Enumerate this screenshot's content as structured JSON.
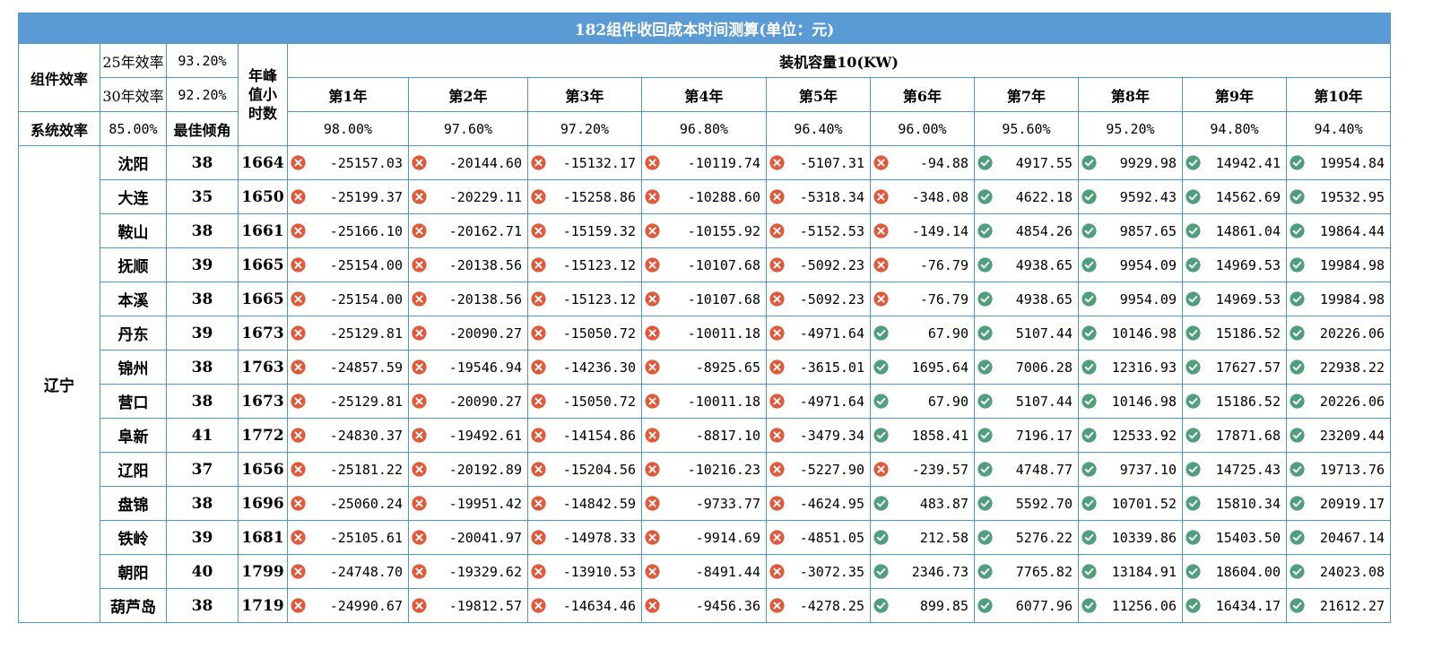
{
  "title": "182组件收回成本时间测算(单位：元)",
  "labels": {
    "module_eff": "组件效率",
    "eff25_label": "25年效率",
    "eff25_value": "93.20%",
    "eff30_label": "30年效率",
    "eff30_value": "92.20%",
    "peak_hours": "年峰值小时数",
    "capacity": "装机容量10(KW)",
    "system_eff": "系统效率",
    "system_eff_value": "85.00%",
    "best_tilt": "最佳倾角",
    "province": "辽宁"
  },
  "years": [
    "第1年",
    "第2年",
    "第3年",
    "第4年",
    "第5年",
    "第6年",
    "第7年",
    "第8年",
    "第9年",
    "第10年"
  ],
  "year_efficiency": [
    "98.00%",
    "97.60%",
    "97.20%",
    "96.80%",
    "96.40%",
    "96.00%",
    "95.60%",
    "95.20%",
    "94.80%",
    "94.40%"
  ],
  "icons": {
    "negative": "x-circle-icon",
    "positive": "check-circle-icon",
    "negative_color": "#e05a3a",
    "positive_color": "#4f9e7c",
    "border_color": "#4f96cf",
    "title_bg": "#5b9bd5"
  },
  "rows": [
    {
      "city": "沈阳",
      "angle": "38",
      "peak": "1664",
      "values": [
        "-25157.03",
        "-20144.60",
        "-15132.17",
        "-10119.74",
        "-5107.31",
        "-94.88",
        "4917.55",
        "9929.98",
        "14942.41",
        "19954.84"
      ]
    },
    {
      "city": "大连",
      "angle": "35",
      "peak": "1650",
      "values": [
        "-25199.37",
        "-20229.11",
        "-15258.86",
        "-10288.60",
        "-5318.34",
        "-348.08",
        "4622.18",
        "9592.43",
        "14562.69",
        "19532.95"
      ]
    },
    {
      "city": "鞍山",
      "angle": "38",
      "peak": "1661",
      "values": [
        "-25166.10",
        "-20162.71",
        "-15159.32",
        "-10155.92",
        "-5152.53",
        "-149.14",
        "4854.26",
        "9857.65",
        "14861.04",
        "19864.44"
      ]
    },
    {
      "city": "抚顺",
      "angle": "39",
      "peak": "1665",
      "values": [
        "-25154.00",
        "-20138.56",
        "-15123.12",
        "-10107.68",
        "-5092.23",
        "-76.79",
        "4938.65",
        "9954.09",
        "14969.53",
        "19984.98"
      ]
    },
    {
      "city": "本溪",
      "angle": "38",
      "peak": "1665",
      "values": [
        "-25154.00",
        "-20138.56",
        "-15123.12",
        "-10107.68",
        "-5092.23",
        "-76.79",
        "4938.65",
        "9954.09",
        "14969.53",
        "19984.98"
      ]
    },
    {
      "city": "丹东",
      "angle": "39",
      "peak": "1673",
      "values": [
        "-25129.81",
        "-20090.27",
        "-15050.72",
        "-10011.18",
        "-4971.64",
        "67.90",
        "5107.44",
        "10146.98",
        "15186.52",
        "20226.06"
      ]
    },
    {
      "city": "锦州",
      "angle": "38",
      "peak": "1763",
      "values": [
        "-24857.59",
        "-19546.94",
        "-14236.30",
        "-8925.65",
        "-3615.01",
        "1695.64",
        "7006.28",
        "12316.93",
        "17627.57",
        "22938.22"
      ]
    },
    {
      "city": "营口",
      "angle": "38",
      "peak": "1673",
      "values": [
        "-25129.81",
        "-20090.27",
        "-15050.72",
        "-10011.18",
        "-4971.64",
        "67.90",
        "5107.44",
        "10146.98",
        "15186.52",
        "20226.06"
      ]
    },
    {
      "city": "阜新",
      "angle": "41",
      "peak": "1772",
      "values": [
        "-24830.37",
        "-19492.61",
        "-14154.86",
        "-8817.10",
        "-3479.34",
        "1858.41",
        "7196.17",
        "12533.92",
        "17871.68",
        "23209.44"
      ]
    },
    {
      "city": "辽阳",
      "angle": "37",
      "peak": "1656",
      "values": [
        "-25181.22",
        "-20192.89",
        "-15204.56",
        "-10216.23",
        "-5227.90",
        "-239.57",
        "4748.77",
        "9737.10",
        "14725.43",
        "19713.76"
      ]
    },
    {
      "city": "盘锦",
      "angle": "38",
      "peak": "1696",
      "values": [
        "-25060.24",
        "-19951.42",
        "-14842.59",
        "-9733.77",
        "-4624.95",
        "483.87",
        "5592.70",
        "10701.52",
        "15810.34",
        "20919.17"
      ]
    },
    {
      "city": "铁岭",
      "angle": "39",
      "peak": "1681",
      "values": [
        "-25105.61",
        "-20041.97",
        "-14978.33",
        "-9914.69",
        "-4851.05",
        "212.58",
        "5276.22",
        "10339.86",
        "15403.50",
        "20467.14"
      ]
    },
    {
      "city": "朝阳",
      "angle": "40",
      "peak": "1799",
      "values": [
        "-24748.70",
        "-19329.62",
        "-13910.53",
        "-8491.44",
        "-3072.35",
        "2346.73",
        "7765.82",
        "13184.91",
        "18604.00",
        "24023.08"
      ]
    },
    {
      "city": "葫芦岛",
      "angle": "38",
      "peak": "1719",
      "values": [
        "-24990.67",
        "-19812.57",
        "-14634.46",
        "-9456.36",
        "-4278.25",
        "899.85",
        "6077.96",
        "11256.06",
        "16434.17",
        "21612.27"
      ]
    }
  ]
}
